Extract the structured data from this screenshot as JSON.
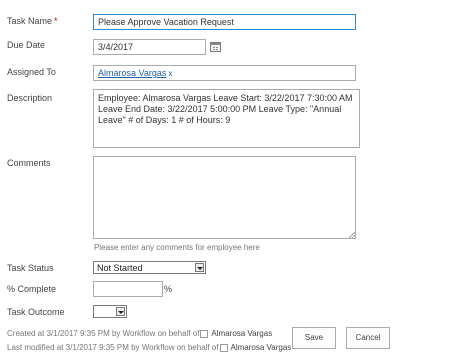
{
  "form": {
    "task_name": {
      "label": "Task Name",
      "required_marker": "*",
      "value": "Please Approve Vacation Request"
    },
    "due_date": {
      "label": "Due Date",
      "value": "3/4/2017",
      "icon": "calendar-icon"
    },
    "assigned_to": {
      "label": "Assigned To",
      "person": "Almarosa Vargas",
      "remove_glyph": "x"
    },
    "description": {
      "label": "Description",
      "value": "Employee: Almarosa Vargas Leave Start: 3/22/2017 7:30:00 AM Leave End Date: 3/22/2017 5:00:00 PM Leave Type: \"Annual Leave\" # of Days: 1 # of Hours: 9"
    },
    "comments": {
      "label": "Comments",
      "value": "",
      "hint": "Please enter any comments for employee here"
    },
    "task_status": {
      "label": "Task Status",
      "selected": "Not Started"
    },
    "percent_complete": {
      "label": "% Complete",
      "value": "",
      "unit": "%"
    },
    "task_outcome": {
      "label": "Task Outcome",
      "selected": ""
    }
  },
  "footer": {
    "created_prefix": "Created at 3/1/2017 9:35 PM  by Workflow on behalf of",
    "created_by": "Almarosa Vargas",
    "modified_prefix": "Last modified at 3/1/2017 9:35 PM  by Workflow on behalf of",
    "modified_by": "Almarosa Vargas",
    "save_label": "Save",
    "cancel_label": "Cancel"
  }
}
